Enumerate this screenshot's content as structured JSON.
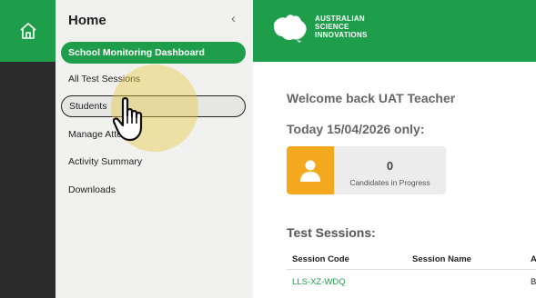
{
  "sidebar": {
    "title": "Home",
    "collapse_glyph": "‹",
    "items": [
      {
        "label": "School Monitoring Dashboard",
        "state": "active"
      },
      {
        "label": "All Test Sessions"
      },
      {
        "label": "Students",
        "state": "hover"
      },
      {
        "label": "Manage Atten"
      },
      {
        "label": "Activity Summary"
      },
      {
        "label": "Downloads"
      }
    ]
  },
  "header": {
    "logo_lines": [
      "AUSTRALIAN",
      "SCIENCE",
      "INNOVATIONS"
    ]
  },
  "main": {
    "welcome": "Welcome back UAT Teacher",
    "today": "Today 15/04/2026 only:",
    "stat": {
      "count": "0",
      "label": "Candidates in Progress",
      "icon": "person-icon"
    },
    "sessions": {
      "title": "Test Sessions:",
      "columns": [
        "Session Code",
        "Session Name",
        "A"
      ],
      "rows": [
        {
          "code": "LLS-XZ-WDQ",
          "name": "",
          "extra": "B"
        }
      ]
    }
  },
  "colors": {
    "brand_green": "#1e9e4a",
    "rail_dark": "#2b2b2b",
    "sidebar_bg": "#f1f1ef",
    "stat_orange": "#f4a81d"
  },
  "icons": [
    "home-icon",
    "chevron-left-icon",
    "person-icon",
    "hand-cursor-icon",
    "australia-map-icon"
  ]
}
